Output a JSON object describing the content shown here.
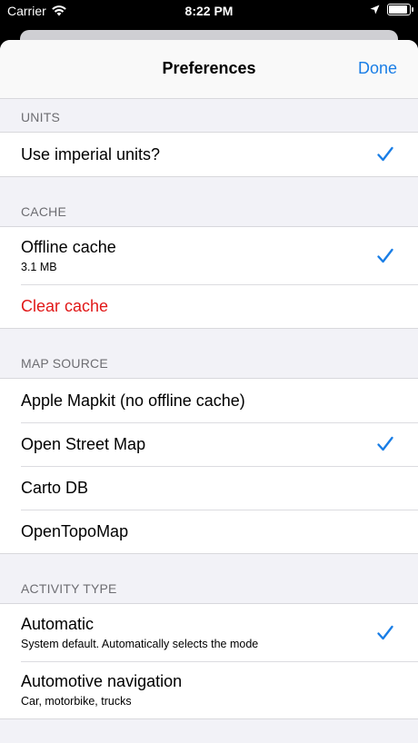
{
  "status_bar": {
    "carrier": "Carrier",
    "time": "8:22 PM"
  },
  "nav": {
    "title": "Preferences",
    "done_label": "Done"
  },
  "sections": {
    "units": {
      "header": "UNITS",
      "imperial": {
        "label": "Use imperial units?",
        "checked": true
      }
    },
    "cache": {
      "header": "CACHE",
      "offline": {
        "label": "Offline cache",
        "detail": "3.1 MB",
        "checked": true
      },
      "clear": {
        "label": "Clear cache"
      }
    },
    "map_source": {
      "header": "MAP SOURCE",
      "items": [
        {
          "label": "Apple Mapkit (no offline cache)",
          "checked": false
        },
        {
          "label": "Open Street Map",
          "checked": true
        },
        {
          "label": "Carto DB",
          "checked": false
        },
        {
          "label": "OpenTopoMap",
          "checked": false
        }
      ]
    },
    "activity_type": {
      "header": "ACTIVITY TYPE",
      "items": [
        {
          "label": "Automatic",
          "detail": "System default. Automatically selects the mode",
          "checked": true
        },
        {
          "label": "Automotive navigation",
          "detail": "Car, motorbike, trucks",
          "checked": false
        }
      ]
    }
  },
  "colors": {
    "accent": "#1a7ee6",
    "destructive": "#e11818",
    "group_background": "#f2f2f7"
  },
  "icons": {
    "wifi": "wifi-icon",
    "location": "location-arrow-icon",
    "battery": "battery-icon",
    "check": "checkmark-icon"
  }
}
